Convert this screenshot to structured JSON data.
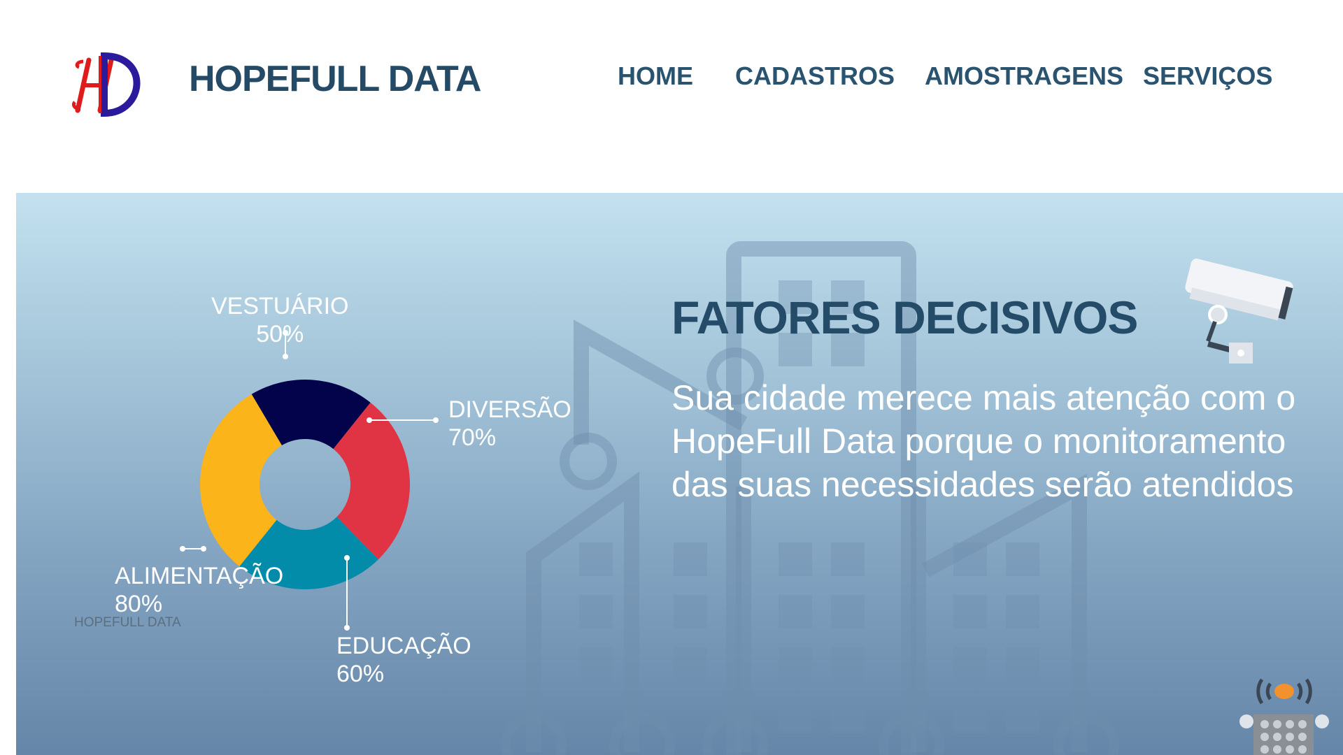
{
  "header": {
    "logo_text": "HD",
    "brand_name": "HOPEFULL DATA"
  },
  "nav": {
    "items": [
      {
        "label": "HOME"
      },
      {
        "label": "CADASTROS"
      },
      {
        "label": "AMOSTRAGENS"
      },
      {
        "label": "SERVIÇOS"
      }
    ]
  },
  "hero": {
    "title": "FATORES DECISIVOS",
    "text": "Sua cidade merece mais atenção com o HopeFull Data porque o monitoramento das suas necessidades serão atendidos",
    "watermark": "HOPEFULL DATA"
  },
  "chart_data": {
    "type": "pie",
    "style": "donut",
    "categories": [
      "VESTUÁRIO",
      "DIVERSÃO",
      "EDUCAÇÃO",
      "ALIMENTAÇÃO"
    ],
    "value_labels": [
      "50%",
      "70%",
      "60%",
      "80%"
    ],
    "values": [
      50,
      70,
      60,
      80
    ],
    "colors": [
      "#03034b",
      "#e03444",
      "#038baa",
      "#fbb419"
    ]
  },
  "colors": {
    "brand_dark": "#254a66",
    "logo_red": "#e01b1b",
    "logo_blue": "#2b1a9c",
    "label_white": "#ffffff"
  },
  "icons": [
    "security-camera-icon",
    "radio-tower-icon",
    "city-building-icon"
  ]
}
